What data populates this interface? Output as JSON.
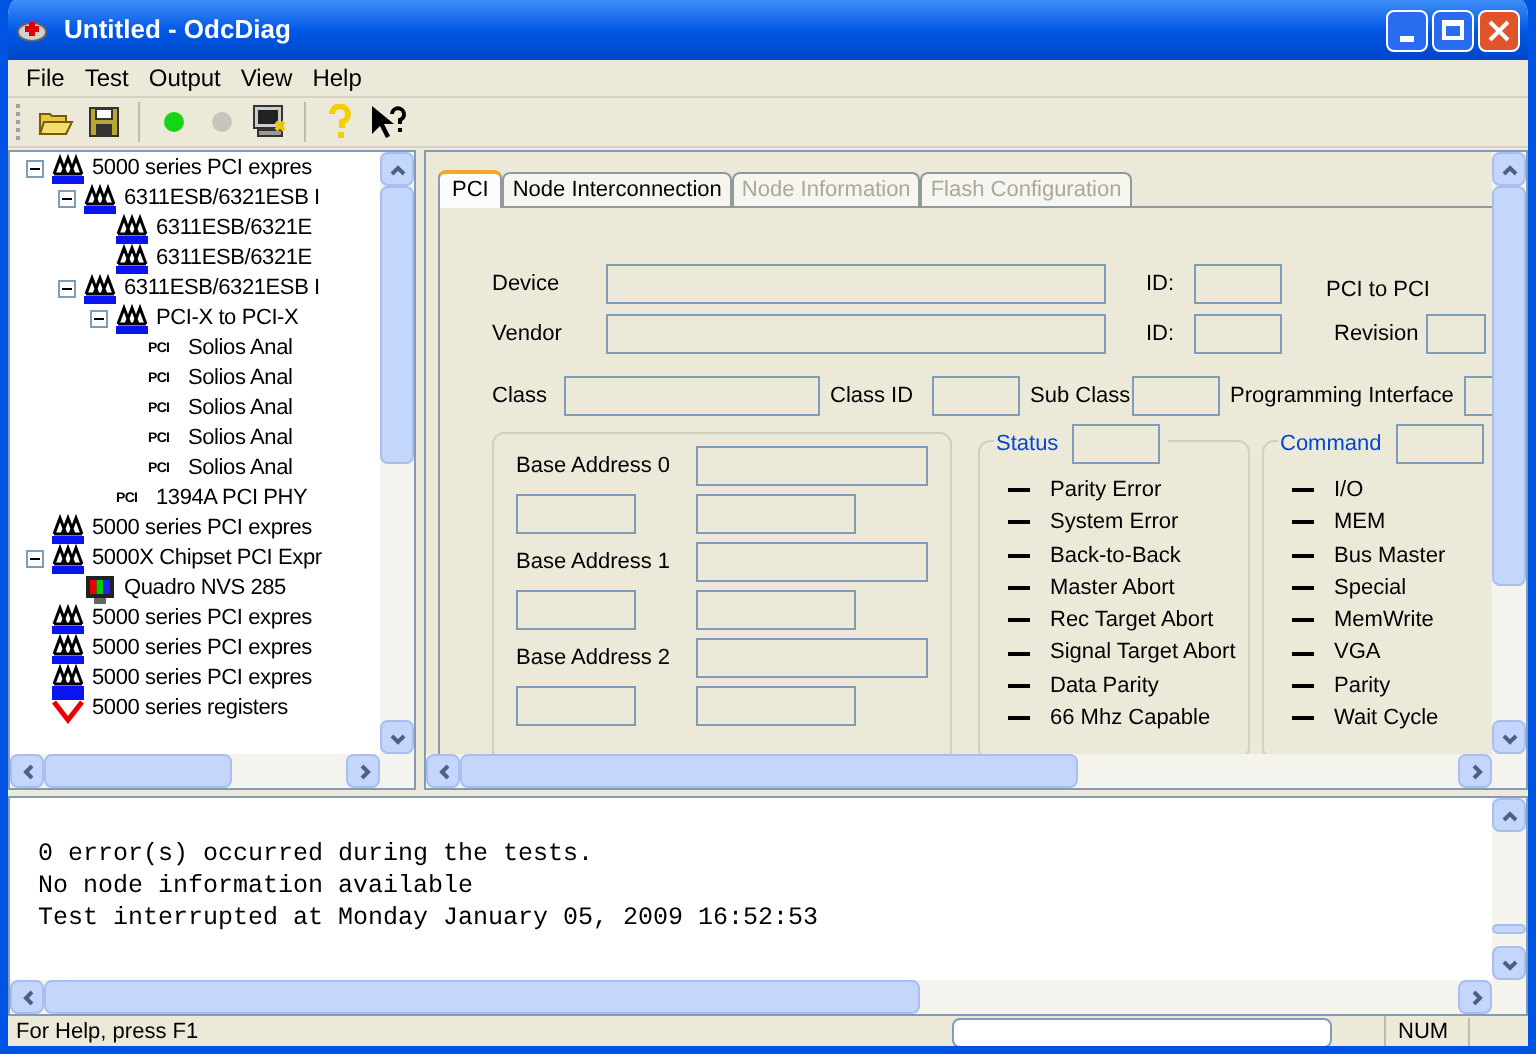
{
  "window": {
    "title": "Untitled - OdcDiag"
  },
  "menu": [
    {
      "label": "File"
    },
    {
      "label": "Test"
    },
    {
      "label": "Output"
    },
    {
      "label": "View"
    },
    {
      "label": "Help"
    }
  ],
  "toolbar": [
    {
      "kind": "open",
      "disabled": false
    },
    {
      "kind": "save",
      "disabled": false
    },
    {
      "kind": "separator"
    },
    {
      "kind": "run",
      "disabled": false
    },
    {
      "kind": "stop",
      "disabled": true
    },
    {
      "kind": "monitor",
      "disabled": false
    },
    {
      "kind": "separator"
    },
    {
      "kind": "help",
      "disabled": false
    },
    {
      "kind": "context-help",
      "disabled": false
    }
  ],
  "tree": [
    {
      "label": "5000 series PCI expres",
      "kind": "bridge",
      "expanded": true,
      "children": [
        {
          "label": "6311ESB/6321ESB I",
          "kind": "bridge",
          "expanded": true,
          "children": [
            {
              "label": "6311ESB/6321E",
              "kind": "bridge"
            },
            {
              "label": "6311ESB/6321E",
              "kind": "bridge"
            }
          ]
        },
        {
          "label": "6311ESB/6321ESB I",
          "kind": "bridge",
          "expanded": true,
          "children": [
            {
              "label": "PCI-X to PCI-X",
              "kind": "bridge",
              "expanded": true,
              "children": [
                {
                  "label": "Solios Anal",
                  "kind": "pci",
                  "badge": "PCI"
                },
                {
                  "label": "Solios Anal",
                  "kind": "pci",
                  "badge": "PCI"
                },
                {
                  "label": "Solios Anal",
                  "kind": "pci",
                  "badge": "PCI"
                },
                {
                  "label": "Solios Anal",
                  "kind": "pci",
                  "badge": "PCI"
                },
                {
                  "label": "Solios Anal",
                  "kind": "pci",
                  "badge": "PCI"
                }
              ]
            },
            {
              "label": "1394A PCI PHY",
              "kind": "pci",
              "badge": "PCI"
            }
          ]
        }
      ]
    },
    {
      "label": "5000 series PCI expres",
      "kind": "bridge"
    },
    {
      "label": "5000X Chipset PCI Expr",
      "kind": "bridge",
      "expanded": true,
      "children": [
        {
          "label": "Quadro NVS 285",
          "kind": "display"
        }
      ]
    },
    {
      "label": "5000 series PCI expres",
      "kind": "bridge"
    },
    {
      "label": "5000 series PCI expres",
      "kind": "bridge"
    },
    {
      "label": "5000 series PCI expres",
      "kind": "bridge"
    },
    {
      "label": "5000 series registers",
      "kind": "registers"
    }
  ],
  "tabs": [
    {
      "label": "PCI",
      "selected": true,
      "disabled": false
    },
    {
      "label": "Node Interconnection",
      "selected": false,
      "disabled": false
    },
    {
      "label": "Node Information",
      "selected": false,
      "disabled": true
    },
    {
      "label": "Flash Configuration",
      "selected": false,
      "disabled": true
    }
  ],
  "pci": {
    "device_label": "Device",
    "vendor_label": "Vendor",
    "device_id_label": "ID:",
    "vendor_id_label": "ID:",
    "bridge_label": "PCI to PCI",
    "revision_label": "Revision",
    "class_label": "Class",
    "class_id_label": "Class ID",
    "sub_class_label": "Sub Class",
    "prog_if_label": "Programming Interface",
    "base_addresses": [
      "Base Address 0",
      "Base Address 1",
      "Base Address 2"
    ],
    "status": {
      "title": "Status",
      "items": [
        "Parity Error",
        "System Error",
        "Back-to-Back",
        "Master Abort",
        "Rec Target Abort",
        "Signal Target Abort",
        "Data Parity",
        "66 Mhz Capable"
      ]
    },
    "command": {
      "title": "Command",
      "items": [
        "I/O",
        "MEM",
        "Bus Master",
        "Special",
        "MemWrite",
        "VGA",
        "Parity",
        "Wait Cycle"
      ]
    }
  },
  "output": [
    "0 error(s) occurred during the tests.",
    "No node information available",
    "Test interrupted at Monday January 05, 2009 16:52:53"
  ],
  "status_bar": {
    "message": "For Help, press F1",
    "progress": {
      "level": 0
    },
    "num": "NUM"
  }
}
